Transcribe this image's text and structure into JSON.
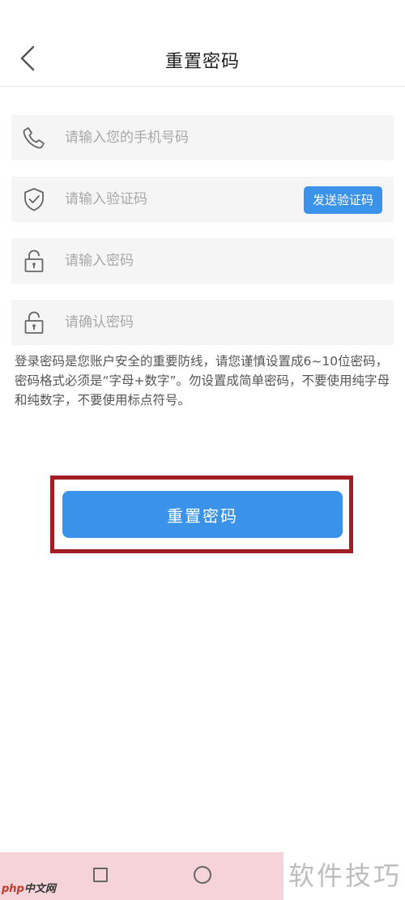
{
  "header": {
    "title": "重置密码",
    "back_icon": "chevron-left-icon"
  },
  "form": {
    "phone": {
      "icon": "phone-icon",
      "value": "",
      "placeholder": "请输入您的手机号码"
    },
    "code": {
      "icon": "shield-check-icon",
      "value": "",
      "placeholder": "请输入验证码",
      "send_label": "发送验证码"
    },
    "password": {
      "icon": "lock-icon",
      "value": "",
      "placeholder": "请输入密码"
    },
    "confirm": {
      "icon": "lock-icon",
      "value": "",
      "placeholder": "请确认密码"
    }
  },
  "notice": "登录密码是您账户安全的重要防线，请您谨慎设置成6~10位密码，密码格式必须是“字母+数字”。勿设置成简单密码，不要使用纯字母和纯数字，不要使用标点符号。",
  "submit": {
    "label": "重置密码",
    "highlight_color": "#a31e24"
  },
  "colors": {
    "accent": "#3a93e8",
    "field_bg": "#f5f5f5",
    "placeholder": "#a8a8a8"
  },
  "watermark": {
    "logo_php": "php",
    "logo_rest": "中文网",
    "right_text": "软件技巧"
  }
}
